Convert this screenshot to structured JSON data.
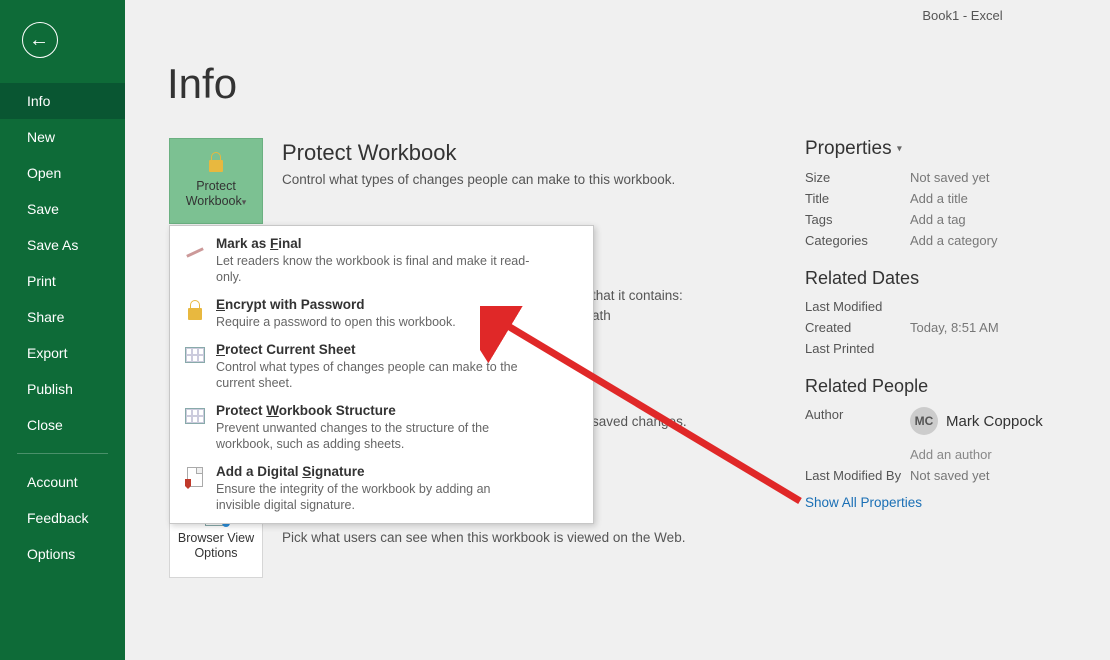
{
  "window": {
    "title": "Book1  -  Excel"
  },
  "sidebar": {
    "items": [
      {
        "label": "Info",
        "active": true
      },
      {
        "label": "New"
      },
      {
        "label": "Open"
      },
      {
        "label": "Save"
      },
      {
        "label": "Save As"
      },
      {
        "label": "Print"
      },
      {
        "label": "Share"
      },
      {
        "label": "Export"
      },
      {
        "label": "Publish"
      },
      {
        "label": "Close"
      }
    ],
    "secondary": [
      {
        "label": "Account"
      },
      {
        "label": "Feedback"
      },
      {
        "label": "Options"
      }
    ]
  },
  "page": {
    "heading": "Info"
  },
  "protect": {
    "tile_label_line1": "Protect",
    "tile_label_line2": "Workbook",
    "section_title": "Protect Workbook",
    "section_desc": "Control what types of changes people can make to this workbook.",
    "menu": [
      {
        "title": "Mark as Final",
        "underline_char": "F",
        "desc": "Let readers know the workbook is final and make it read-only."
      },
      {
        "title": "Encrypt with Password",
        "underline_char": "E",
        "desc": "Require a password to open this workbook."
      },
      {
        "title": "Protect Current Sheet",
        "underline_char": "P",
        "desc": "Control what types of changes people can make to the current sheet."
      },
      {
        "title": "Protect Workbook Structure",
        "underline_char": "W",
        "desc": "Prevent unwanted changes to the structure of the workbook, such as adding sheets."
      },
      {
        "title": "Add a Digital Signature",
        "underline_char": "S",
        "desc": "Ensure the integrity of the workbook by adding an invisible digital signature."
      }
    ]
  },
  "obscured": {
    "line1_suffix": "that it contains:",
    "line1b": "ath",
    "line2_suffix": "saved changes."
  },
  "browser_view": {
    "tile_label_line1": "Browser View",
    "tile_label_line2": "Options",
    "section_desc": "Pick what users can see when this workbook is viewed on the Web."
  },
  "properties": {
    "heading": "Properties",
    "rows": [
      {
        "label": "Size",
        "value": "Not saved yet"
      },
      {
        "label": "Title",
        "value": "Add a title"
      },
      {
        "label": "Tags",
        "value": "Add a tag"
      },
      {
        "label": "Categories",
        "value": "Add a category"
      }
    ],
    "related_dates_heading": "Related Dates",
    "dates": [
      {
        "label": "Last Modified",
        "value": ""
      },
      {
        "label": "Created",
        "value": "Today, 8:51 AM"
      },
      {
        "label": "Last Printed",
        "value": ""
      }
    ],
    "related_people_heading": "Related People",
    "author_label": "Author",
    "author_initials": "MC",
    "author_name": "Mark Coppock",
    "add_author": "Add an author",
    "last_mod_by_label": "Last Modified By",
    "last_mod_by_value": "Not saved yet",
    "show_all": "Show All Properties"
  }
}
